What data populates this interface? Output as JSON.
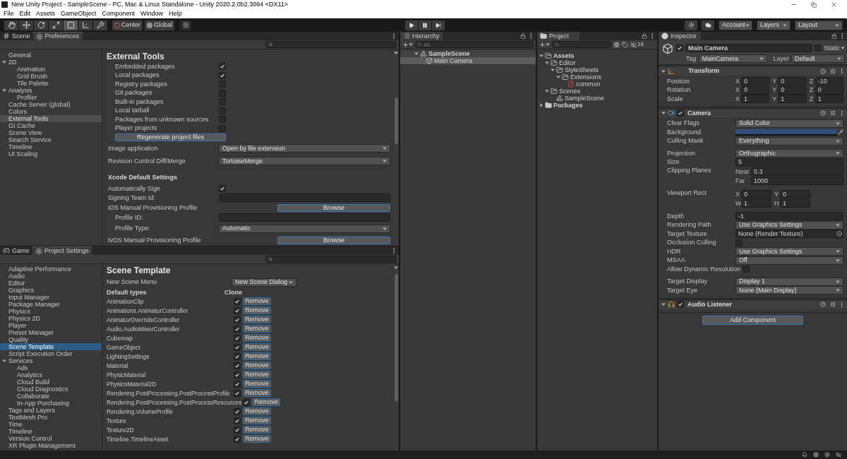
{
  "title_bar": {
    "title": "New Unity Project - SampleScene - PC, Mac & Linux Standalone - Unity 2020.2.0b2.3094 <DX11>"
  },
  "menu": [
    "File",
    "Edit",
    "Assets",
    "GameObject",
    "Component",
    "Window",
    "Help"
  ],
  "toolbar": {
    "tools": [
      {
        "kind": "hand",
        "selected": false
      },
      {
        "kind": "move",
        "selected": false
      },
      {
        "kind": "rotate",
        "selected": false
      },
      {
        "kind": "scale",
        "selected": false
      },
      {
        "kind": "rect",
        "selected": true
      },
      {
        "kind": "transform",
        "selected": false
      },
      {
        "kind": "custom",
        "selected": false
      }
    ],
    "pivot": "Center",
    "space": "Global",
    "account": "Account",
    "layers": "Layers",
    "layout": "Layout"
  },
  "preferences": {
    "focused": false,
    "tabs": [
      {
        "label": "Scene",
        "kind": "scene",
        "selected": false
      },
      {
        "label": "Preferences",
        "kind": "settings",
        "selected": true
      }
    ],
    "sidebar": [
      {
        "label": "General",
        "selected": false
      },
      {
        "label": "2D",
        "selected": false,
        "expanded": true,
        "children": [
          {
            "label": "Animation",
            "selected": false
          },
          {
            "label": "Grid Brush",
            "selected": false
          },
          {
            "label": "Tile Palette",
            "selected": false
          }
        ]
      },
      {
        "label": "Analysis",
        "selected": false,
        "expanded": true,
        "children": [
          {
            "label": "Profiler",
            "selected": false
          }
        ]
      },
      {
        "label": "Cache Server (global)",
        "selected": false
      },
      {
        "label": "Colors",
        "selected": false
      },
      {
        "label": "External Tools",
        "selected": true
      },
      {
        "label": "GI Cache",
        "selected": false
      },
      {
        "label": "Scene View",
        "selected": false
      },
      {
        "label": "Search Service",
        "selected": false
      },
      {
        "label": "Timeline",
        "selected": false
      },
      {
        "label": "UI Scaling",
        "selected": false
      }
    ],
    "title": "External Tools",
    "rows": [
      {
        "kind": "checkbox",
        "label": "Embedded packages",
        "checked": true,
        "indented": true
      },
      {
        "kind": "checkbox",
        "label": "Local packages",
        "checked": true,
        "indented": true
      },
      {
        "kind": "checkbox",
        "label": "Registry packages",
        "checked": false,
        "indented": true
      },
      {
        "kind": "checkbox",
        "label": "Git packages",
        "checked": false,
        "indented": true
      },
      {
        "kind": "checkbox",
        "label": "Built-in packages",
        "checked": false,
        "indented": true
      },
      {
        "kind": "checkbox",
        "label": "Local tarball",
        "checked": false,
        "indented": true
      },
      {
        "kind": "checkbox",
        "label": "Packages from unknown sources",
        "checked": false,
        "indented": true
      },
      {
        "kind": "checkbox",
        "label": "Player projects",
        "checked": false,
        "indented": true
      },
      {
        "kind": "button",
        "label": "Regenerate project files",
        "indented": true
      },
      {
        "kind": "dropdown",
        "label": "Image application",
        "value": "Open by file extension",
        "indented": false
      },
      {
        "kind": "dropdown",
        "label": "Revision Control Diff/Merge",
        "value": "TortoiseMerge",
        "indented": false
      },
      {
        "kind": "heading",
        "label": "Xcode Default Settings",
        "indented": false
      },
      {
        "kind": "checkbox",
        "label": "Automatically Sign",
        "checked": true,
        "indented": false
      },
      {
        "kind": "text",
        "label": "Signing Team Id:",
        "indented": false
      },
      {
        "kind": "browse",
        "label": "iOS Manual Provisioning Profile",
        "button": "Browse",
        "indented": false
      },
      {
        "kind": "text",
        "label": "Profile ID:",
        "indented": true
      },
      {
        "kind": "dropdown",
        "label": "Profile Type:",
        "value": "Automatic",
        "indented": true
      },
      {
        "kind": "browse",
        "label": "tvOS Manual Provisioning Profile",
        "button": "Browse",
        "indented": false
      }
    ]
  },
  "project_settings": {
    "focused": true,
    "tabs": [
      {
        "label": "Game",
        "kind": "game",
        "selected": false
      },
      {
        "label": "Project Settings",
        "kind": "settings",
        "selected": true
      }
    ],
    "sidebar": [
      {
        "label": "Adaptive Performance",
        "selected": false
      },
      {
        "label": "Audio",
        "selected": false
      },
      {
        "label": "Editor",
        "selected": false
      },
      {
        "label": "Graphics",
        "selected": false
      },
      {
        "label": "Input Manager",
        "selected": false
      },
      {
        "label": "Package Manager",
        "selected": false
      },
      {
        "label": "Physics",
        "selected": false
      },
      {
        "label": "Physics 2D",
        "selected": false
      },
      {
        "label": "Player",
        "selected": false
      },
      {
        "label": "Preset Manager",
        "selected": false
      },
      {
        "label": "Quality",
        "selected": false
      },
      {
        "label": "Scene Template",
        "selected": true
      },
      {
        "label": "Script Execution Order",
        "selected": false
      },
      {
        "label": "Services",
        "selected": false,
        "expanded": true,
        "children": [
          {
            "label": "Ads",
            "selected": false
          },
          {
            "label": "Analytics",
            "selected": false
          },
          {
            "label": "Cloud Build",
            "selected": false
          },
          {
            "label": "Cloud Diagnostics",
            "selected": false
          },
          {
            "label": "Collaborate",
            "selected": false
          },
          {
            "label": "In-App Purchasing",
            "selected": false
          }
        ]
      },
      {
        "label": "Tags and Layers",
        "selected": false
      },
      {
        "label": "TextMesh Pro",
        "selected": false
      },
      {
        "label": "Time",
        "selected": false
      },
      {
        "label": "Timeline",
        "selected": false
      },
      {
        "label": "Version Control",
        "selected": false
      },
      {
        "label": "XR Plugin Management",
        "selected": false
      }
    ],
    "title": "Scene Template",
    "new_scene_menu": {
      "label": "New Scene Menu",
      "value": "New Scene Dialog"
    },
    "columns": [
      "Default types",
      "Clone"
    ],
    "types": [
      {
        "name": "AnimationClip",
        "clone": true,
        "button": "Remove"
      },
      {
        "name": "Animations.AnimatorController",
        "clone": true,
        "button": "Remove"
      },
      {
        "name": "AnimatorOverrideController",
        "clone": true,
        "button": "Remove"
      },
      {
        "name": "Audio.AudioMixerController",
        "clone": true,
        "button": "Remove"
      },
      {
        "name": "Cubemap",
        "clone": true,
        "button": "Remove"
      },
      {
        "name": "GameObject",
        "clone": true,
        "button": "Remove"
      },
      {
        "name": "LightingSettings",
        "clone": true,
        "button": "Remove"
      },
      {
        "name": "Material",
        "clone": true,
        "button": "Remove"
      },
      {
        "name": "PhysicMaterial",
        "clone": true,
        "button": "Remove"
      },
      {
        "name": "PhysicsMaterial2D",
        "clone": true,
        "button": "Remove"
      },
      {
        "name": "Rendering.PostProcessing.PostProcessProfile",
        "clone": true,
        "button": "Remove"
      },
      {
        "name": "Rendering.PostProcessing.PostProcessResources",
        "clone": true,
        "button": "Remove"
      },
      {
        "name": "Rendering.VolumeProfile",
        "clone": true,
        "button": "Remove"
      },
      {
        "name": "Texture",
        "clone": true,
        "button": "Remove"
      },
      {
        "name": "Texture2D",
        "clone": true,
        "button": "Remove"
      },
      {
        "name": "Timeline.TimelineAsset",
        "clone": true,
        "button": "Remove"
      }
    ]
  },
  "hierarchy": {
    "tab": "Hierarchy",
    "search": {
      "placeholder": "All"
    },
    "tree": [
      {
        "label": "SampleScene",
        "kind": "scene",
        "selected": false,
        "expanded": true,
        "children": [
          {
            "label": "Main Camera",
            "kind": "gameobject",
            "selected": true
          }
        ]
      }
    ]
  },
  "project": {
    "tab": "Project",
    "hidden_count": "18",
    "tree": [
      {
        "label": "Assets",
        "kind": "folder",
        "selected": false,
        "expanded": true,
        "children": [
          {
            "label": "Editor",
            "kind": "folder",
            "selected": false,
            "expanded": true,
            "children": [
              {
                "label": "StyleSheets",
                "kind": "folder",
                "selected": false,
                "expanded": true,
                "children": [
                  {
                    "label": "Extensions",
                    "kind": "folder",
                    "selected": false,
                    "expanded": true,
                    "children": [
                      {
                        "label": "common",
                        "kind": "stylesheet",
                        "selected": false
                      }
                    ]
                  }
                ]
              }
            ]
          },
          {
            "label": "Scenes",
            "kind": "folder",
            "selected": false,
            "expanded": true,
            "children": [
              {
                "label": "SampleScene",
                "kind": "scene",
                "selected": false
              }
            ]
          }
        ]
      },
      {
        "label": "Packages",
        "kind": "folder",
        "selected": false,
        "expanded": false
      }
    ]
  },
  "inspector": {
    "tab": "Inspector",
    "object": {
      "active": true,
      "name": "Main Camera",
      "static_label": "Static",
      "static": false,
      "tag_label": "Tag",
      "tag": "MainCamera",
      "layer_label": "Layer",
      "layer": "Default"
    },
    "components": [
      {
        "kind": "transform",
        "name": "Transform",
        "rows": [
          {
            "kind": "vector",
            "label": "Position",
            "values": [
              {
                "axis": "X",
                "value": "0"
              },
              {
                "axis": "Y",
                "value": "0"
              },
              {
                "axis": "Z",
                "value": "-10"
              }
            ]
          },
          {
            "kind": "vector",
            "label": "Rotation",
            "values": [
              {
                "axis": "X",
                "value": "0"
              },
              {
                "axis": "Y",
                "value": "0"
              },
              {
                "axis": "Z",
                "value": "0"
              }
            ]
          },
          {
            "kind": "vector",
            "label": "Scale",
            "values": [
              {
                "axis": "X",
                "value": "1"
              },
              {
                "axis": "Y",
                "value": "1"
              },
              {
                "axis": "Z",
                "value": "1"
              }
            ]
          }
        ]
      },
      {
        "kind": "camera",
        "name": "Camera",
        "enabled": true,
        "rows": [
          {
            "kind": "dropdown",
            "label": "Clear Flags",
            "value": "Solid Color"
          },
          {
            "kind": "color",
            "label": "Background",
            "color": "#314d79"
          },
          {
            "kind": "dropdown",
            "label": "Culling Mask",
            "value": "Everything"
          },
          {
            "kind": "spacer"
          },
          {
            "kind": "dropdown",
            "label": "Projection",
            "value": "Orthographic"
          },
          {
            "kind": "field",
            "label": "Size",
            "value": "5"
          },
          {
            "kind": "stacked",
            "label": "Clipping Planes",
            "values": [
              {
                "axis": "Near",
                "value": "0.3"
              },
              {
                "axis": "Far",
                "value": "1000"
              }
            ]
          },
          {
            "kind": "spacer"
          },
          {
            "kind": "grid",
            "label": "Viewport Rect",
            "values": [
              {
                "axis": "X",
                "value": "0"
              },
              {
                "axis": "Y",
                "value": "0"
              },
              {
                "axis": "W",
                "value": "1"
              },
              {
                "axis": "H",
                "value": "1"
              }
            ]
          },
          {
            "kind": "spacer"
          },
          {
            "kind": "field",
            "label": "Depth",
            "value": "-1"
          },
          {
            "kind": "dropdown",
            "label": "Rendering Path",
            "value": "Use Graphics Settings"
          },
          {
            "kind": "object",
            "label": "Target Texture",
            "value": "None (Render Texture)"
          },
          {
            "kind": "checkbox",
            "label": "Occlusion Culling",
            "checked": false
          },
          {
            "kind": "dropdown",
            "label": "HDR",
            "value": "Use Graphics Settings"
          },
          {
            "kind": "dropdown",
            "label": "MSAA",
            "value": "Off"
          },
          {
            "kind": "checkbox",
            "label": "Allow Dynamic Resolution",
            "checked": false
          },
          {
            "kind": "spacer"
          },
          {
            "kind": "dropdown",
            "label": "Target Display",
            "value": "Display 1"
          },
          {
            "kind": "dropdown",
            "label": "Target Eye",
            "value": "None (Main Display)"
          }
        ]
      },
      {
        "kind": "audio",
        "name": "Audio Listener",
        "enabled": true
      }
    ],
    "add_button": "Add Component"
  }
}
